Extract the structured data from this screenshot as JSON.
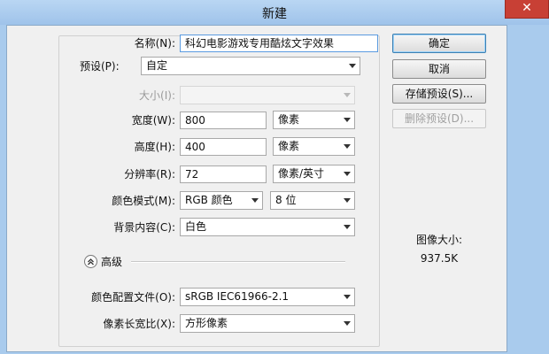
{
  "window": {
    "title": "新建",
    "close_glyph": "✕"
  },
  "form": {
    "name": {
      "label": "名称(N):",
      "value": "科幻电影游戏专用酷炫文字效果"
    },
    "preset": {
      "label": "预设(P):",
      "value": "自定"
    },
    "size": {
      "label": "大小(I):",
      "value": ""
    },
    "width": {
      "label": "宽度(W):",
      "value": "800",
      "unit": "像素"
    },
    "height": {
      "label": "高度(H):",
      "value": "400",
      "unit": "像素"
    },
    "resolution": {
      "label": "分辨率(R):",
      "value": "72",
      "unit": "像素/英寸"
    },
    "color_mode": {
      "label": "颜色模式(M):",
      "value": "RGB 颜色",
      "depth": "8 位"
    },
    "background": {
      "label": "背景内容(C):",
      "value": "白色"
    },
    "advanced": {
      "label": "高级",
      "toggle_icon": "chevron-up-circle-icon"
    },
    "color_profile": {
      "label": "颜色配置文件(O):",
      "value": "sRGB IEC61966-2.1"
    },
    "pixel_aspect": {
      "label": "像素长宽比(X):",
      "value": "方形像素"
    }
  },
  "buttons": {
    "ok": "确定",
    "cancel": "取消",
    "save_preset": "存储预设(S)...",
    "delete_preset": "删除预设(D)..."
  },
  "image_size": {
    "label": "图像大小:",
    "value": "937.5K"
  }
}
